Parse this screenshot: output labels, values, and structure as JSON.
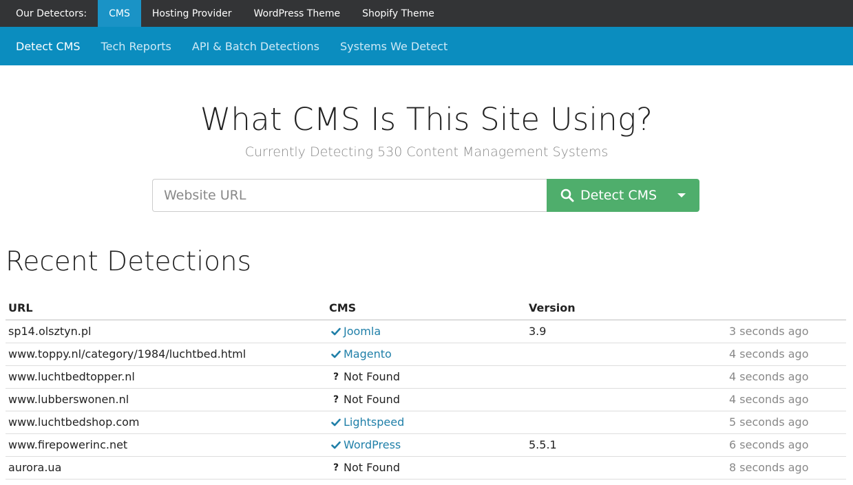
{
  "topnav": {
    "label": "Our Detectors:",
    "items": [
      "CMS",
      "Hosting Provider",
      "WordPress Theme",
      "Shopify Theme"
    ],
    "active": "CMS"
  },
  "subnav": {
    "items": [
      "Detect CMS",
      "Tech Reports",
      "API & Batch Detections",
      "Systems We Detect"
    ],
    "active": "Detect CMS"
  },
  "hero": {
    "title": "What CMS Is This Site Using?",
    "subtitle": "Currently Detecting 530 Content Management Systems"
  },
  "search": {
    "placeholder": "Website URL",
    "button_label": "Detect CMS"
  },
  "recent": {
    "heading": "Recent Detections",
    "columns": [
      "URL",
      "CMS",
      "Version",
      ""
    ],
    "rows": [
      {
        "url": "sp14.olsztyn.pl",
        "cms": "Joomla",
        "found": true,
        "version": "3.9",
        "time": "3 seconds ago"
      },
      {
        "url": "www.toppy.nl/category/1984/luchtbed.html",
        "cms": "Magento",
        "found": true,
        "version": "",
        "time": "4 seconds ago"
      },
      {
        "url": "www.luchtbedtopper.nl",
        "cms": "Not Found",
        "found": false,
        "version": "",
        "time": "4 seconds ago"
      },
      {
        "url": "www.lubberswonen.nl",
        "cms": "Not Found",
        "found": false,
        "version": "",
        "time": "4 seconds ago"
      },
      {
        "url": "www.luchtbedshop.com",
        "cms": "Lightspeed",
        "found": true,
        "version": "",
        "time": "5 seconds ago"
      },
      {
        "url": "www.firepowerinc.net",
        "cms": "WordPress",
        "found": true,
        "version": "5.5.1",
        "time": "6 seconds ago"
      },
      {
        "url": "aurora.ua",
        "cms": "Not Found",
        "found": false,
        "version": "",
        "time": "8 seconds ago"
      }
    ]
  },
  "colors": {
    "topbar": "#333436",
    "topbar_active": "#1a93c6",
    "subbar": "#0b8dbf",
    "detect_button": "#4fae6c",
    "link": "#1f7fa8"
  },
  "icons": {
    "search": "search-icon",
    "found": "check-icon",
    "notfound": "question-icon",
    "dropdown": "caret-down-icon"
  }
}
